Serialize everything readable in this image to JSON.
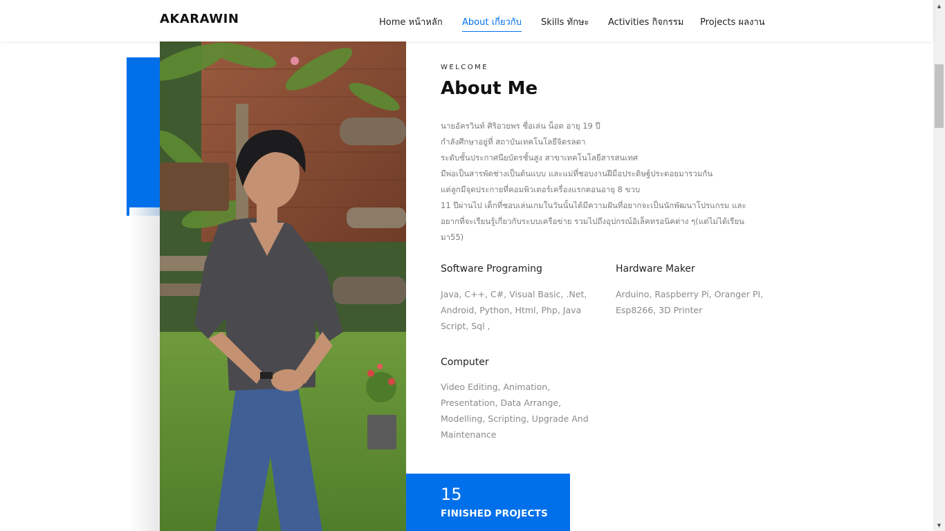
{
  "header": {
    "brand": "AKARAWIN",
    "nav": [
      {
        "label": "Home หน้าหลัก"
      },
      {
        "label": "About เกี่ยวกับ",
        "active": true
      },
      {
        "label": "Skills ทักษะ"
      },
      {
        "label": "Activities กิจกรรม"
      },
      {
        "label": "Projects ผลงาน"
      }
    ]
  },
  "about": {
    "eyebrow": "WELCOME",
    "title": "About Me",
    "bio_lines": [
      "นายอัครวินท์ ศิริอวยพร ชื่อเล่น น็อต อายุ 19 ปี",
      "กำลังศึกษาอยู่ที่ สถาบันเทคโนโลยีจิตรลดา",
      "ระดับชั้นประกาศนียบัตรชั้นสูง สาขาเทคโนโลยีสารสนเทศ",
      "มีพ่อเป็นสารพัดช่างเป็นต้นแบบ และแม่ที่ชอบงานฝีมือประดิษฐ์ประดอยมารวมกัน",
      "แต่ลูกมีจุดประกายที่คอมพิวเตอร์เครื่องแรกตอนอายุ 8 ขวบ",
      "11 ปีผ่านไป เด็กที่ชอบเล่นเกมในวันนั้นได้มีความฝันที่อยากจะเป็นนักพัฒนาโปรแกรม และ",
      "อยากที่จะเรียนรู้เกี่ยวกับระบบเครือข่าย รวมไปถึงอุปกรณ์อิเล็คทรอนิคต่าง ๆ(แต่ไม่ได้เรียน",
      "มา55)"
    ]
  },
  "skills": [
    {
      "title": "Software Programing",
      "body": "Java, C++, C#, Visual Basic, .Net, Android, Python, Html, Php, Java Script, Sql ,"
    },
    {
      "title": "Hardware Maker",
      "body": "Arduino, Raspberry Pi, Oranger PI, Esp8266, 3D Printer"
    },
    {
      "title": "Computer",
      "body": "Video Editing, Animation, Presentation, Data Arrange, Modelling, Scripting, Upgrade And Maintenance"
    }
  ],
  "stat": {
    "number": "15",
    "label": "FINISHED PROJECTS"
  },
  "colors": {
    "accent": "#0070ea",
    "text_muted": "#7a7a7a"
  }
}
